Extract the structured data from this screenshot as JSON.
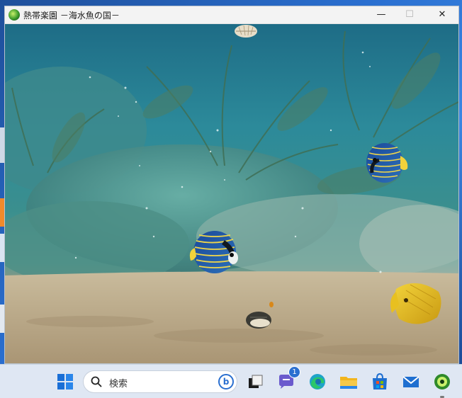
{
  "window": {
    "title": "熱帯楽園 －海水魚の国－",
    "minimize_glyph": "—",
    "maximize_glyph": "☐",
    "close_glyph": "✕"
  },
  "scene": {
    "fish": [
      {
        "species": "emperor-angelfish"
      },
      {
        "species": "emperor-angelfish"
      },
      {
        "species": "yellow-angelfish"
      }
    ],
    "shells": [
      "shell",
      "shell"
    ]
  },
  "taskbar": {
    "search_placeholder": "検索",
    "bing_glyph": "b",
    "teams_badge": "1",
    "icons": [
      "start-icon",
      "task-view-icon",
      "teams-chat-icon",
      "edge-icon",
      "file-explorer-icon",
      "store-icon",
      "mail-icon",
      "aquarium-app-icon"
    ]
  },
  "colors": {
    "taskbar_bg": "#dfe7f3",
    "accent": "#2a6fd0",
    "titlebar_bg": "#f3f3f3"
  }
}
